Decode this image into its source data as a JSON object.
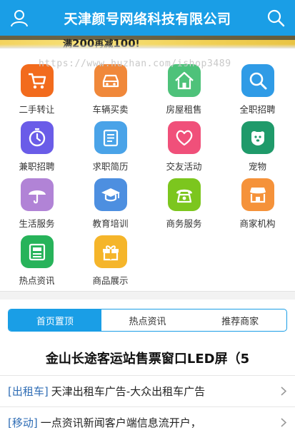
{
  "header": {
    "title": "天津颜号网络科技有限公司",
    "color": "#1a9ee6"
  },
  "banner": {
    "promo_prefix": "满",
    "promo_amount": "200",
    "promo_mid": "再减",
    "promo_discount": "100",
    "promo_suffix": "!"
  },
  "watermark": "https://www.huzhan.com/ishop3489",
  "categories": [
    {
      "label": "二手转让",
      "icon": "cart-icon",
      "color": "#f26b1d"
    },
    {
      "label": "车辆买卖",
      "icon": "car-icon",
      "color": "#f0883a"
    },
    {
      "label": "房屋租售",
      "icon": "house-icon",
      "color": "#4ec27a"
    },
    {
      "label": "全职招聘",
      "icon": "magnifier-icon",
      "color": "#2f9be6"
    },
    {
      "label": "兼职招聘",
      "icon": "clock-icon",
      "color": "#6a5ce8"
    },
    {
      "label": "求职简历",
      "icon": "resume-icon",
      "color": "#4aa3e8"
    },
    {
      "label": "交友活动",
      "icon": "heart-icon",
      "color": "#f0507a"
    },
    {
      "label": "宠物",
      "icon": "dog-icon",
      "color": "#1f9a6a"
    },
    {
      "label": "生活服务",
      "icon": "umbrella-icon",
      "color": "#b183d6"
    },
    {
      "label": "教育培训",
      "icon": "graduation-cap-icon",
      "color": "#4d8fe0"
    },
    {
      "label": "商务服务",
      "icon": "phone-icon",
      "color": "#7cc61e"
    },
    {
      "label": "商家机构",
      "icon": "shop-icon",
      "color": "#f5923a"
    },
    {
      "label": "热点资讯",
      "icon": "newspaper-icon",
      "color": "#27b35a"
    },
    {
      "label": "商品展示",
      "icon": "gift-icon",
      "color": "#f5b52a"
    }
  ],
  "tabs": [
    {
      "label": "首页置顶",
      "active": true
    },
    {
      "label": "热点资讯",
      "active": false
    },
    {
      "label": "推荐商家",
      "active": false
    }
  ],
  "headline": "金山长途客运站售票窗口LED屏（5",
  "news": [
    {
      "tag": "[出租车]",
      "text": "天津出租车广告-大众出租车广告"
    },
    {
      "tag": "[移动]",
      "text": "一点资讯新闻客户端信息流开户，"
    }
  ]
}
